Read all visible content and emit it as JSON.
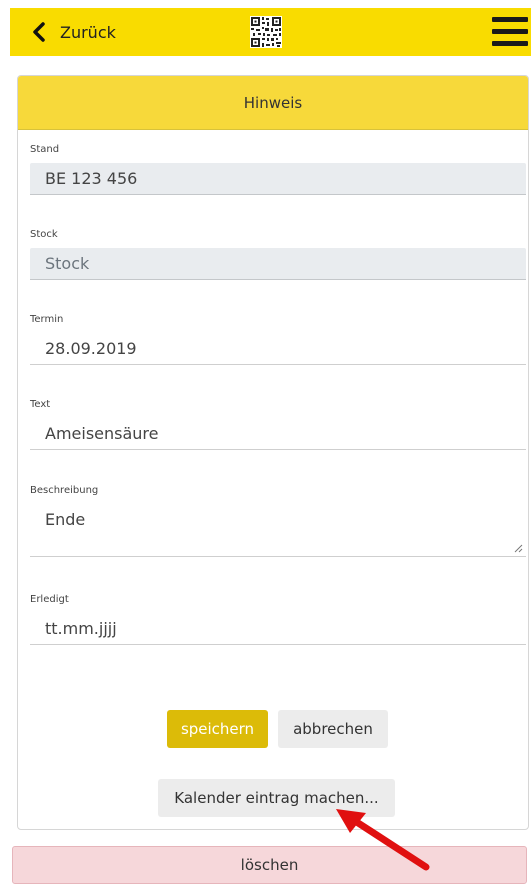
{
  "header": {
    "back_label": "Zurück"
  },
  "card": {
    "title": "Hinweis",
    "fields": [
      {
        "label": "Stand",
        "value": "BE 123 456"
      },
      {
        "label": "Stock",
        "value": "Stock"
      },
      {
        "label": "Termin",
        "value": "28.09.2019"
      },
      {
        "label": "Text",
        "value": "Ameisensäure"
      },
      {
        "label": "Beschreibung",
        "value": "Ende"
      },
      {
        "label": "Erledigt",
        "placeholder": "tt.mm.jjjj"
      }
    ],
    "buttons": {
      "save": "speichern",
      "cancel": "abbrechen",
      "calendar": "Kalender eintrag machen..."
    }
  },
  "footer": {
    "delete": "löschen"
  },
  "colors": {
    "header_bg": "#f9dc00",
    "card_header_bg": "#f7d93a",
    "save_button": "#dcbb08",
    "delete_bg": "#f6d7da",
    "annotation_arrow": "#e01010"
  },
  "icons": [
    "chevron-left-icon",
    "qr-code-icon",
    "hamburger-menu-icon",
    "resize-handle-icon",
    "red-arrow-annotation"
  ]
}
